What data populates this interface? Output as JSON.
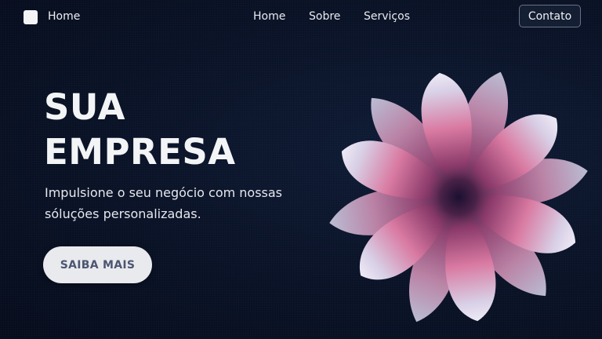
{
  "nav": {
    "brand": "Home",
    "links": [
      "Home",
      "Sobre",
      "Serviços"
    ],
    "contact_label": "Contato"
  },
  "hero": {
    "title_lines": [
      "SUA",
      "EMPRESA"
    ],
    "subtitle_lines": [
      "Impulsione o seu negócio com nossas",
      "sóluções personalizadas."
    ],
    "cta_label": "SAIBA MAIS"
  },
  "icons": {
    "logo": "square-logo-icon",
    "hero_image": "flower-illustration"
  },
  "colors": {
    "background": "#0a1328",
    "cta_background": "#e9eaee",
    "cta_text": "#4c5670",
    "petal_pink": "#e07aa0",
    "petal_light": "#dcdcf0"
  }
}
